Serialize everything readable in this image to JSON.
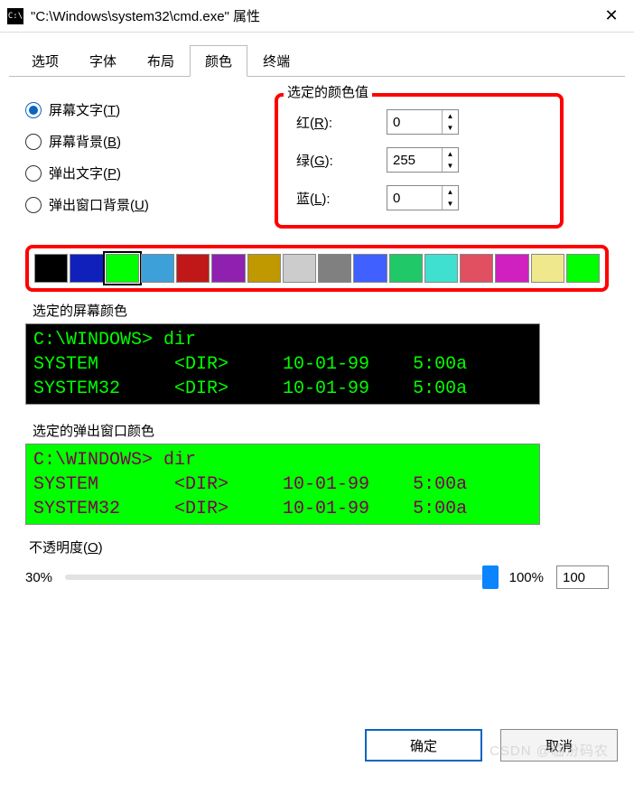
{
  "window": {
    "title": "\"C:\\Windows\\system32\\cmd.exe\" 属性",
    "icon": "C:\\"
  },
  "tabs": {
    "items": [
      {
        "label": "选项"
      },
      {
        "label": "字体"
      },
      {
        "label": "布局"
      },
      {
        "label": "颜色"
      },
      {
        "label": "终端"
      }
    ],
    "active": 3
  },
  "radios": {
    "items": [
      {
        "label": "屏幕文字(",
        "hotkey": "T",
        "suffix": ")",
        "selected": true
      },
      {
        "label": "屏幕背景(",
        "hotkey": "B",
        "suffix": ")",
        "selected": false
      },
      {
        "label": "弹出文字(",
        "hotkey": "P",
        "suffix": ")",
        "selected": false
      },
      {
        "label": "弹出窗口背景(",
        "hotkey": "U",
        "suffix": ")",
        "selected": false
      }
    ]
  },
  "rgb": {
    "legend": "选定的颜色值",
    "rows": [
      {
        "label": "红(",
        "hotkey": "R",
        "suffix": "):",
        "value": "0"
      },
      {
        "label": "绿(",
        "hotkey": "G",
        "suffix": "):",
        "value": "255"
      },
      {
        "label": "蓝(",
        "hotkey": "L",
        "suffix": "):",
        "value": "0"
      }
    ]
  },
  "swatches": {
    "colors": [
      "#000000",
      "#1020bb",
      "#00ff00",
      "#3ea0d8",
      "#c01818",
      "#9020b0",
      "#c09800",
      "#cccccc",
      "#808080",
      "#4060ff",
      "#20c868",
      "#40e0d0",
      "#e05060",
      "#d020c0",
      "#f0e88c",
      "#00ff00"
    ],
    "selected": 2
  },
  "previews": {
    "screen_label": "选定的屏幕颜色",
    "popup_label": "选定的弹出窗口颜色",
    "text": "C:\\WINDOWS> dir\nSYSTEM       <DIR>     10-01-99    5:00a\nSYSTEM32     <DIR>     10-01-99    5:00a"
  },
  "opacity": {
    "label": "不透明度(",
    "hotkey": "O",
    "suffix": ")",
    "min_label": "30%",
    "max_label": "100%",
    "value": "100"
  },
  "buttons": {
    "ok": "确定",
    "cancel": "取消"
  },
  "watermark": "CSDN @临汾码农"
}
